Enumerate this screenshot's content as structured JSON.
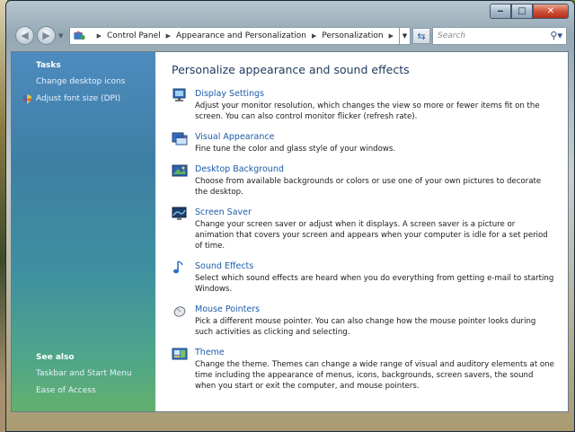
{
  "window": {
    "buttons": {
      "minimize": "‒",
      "maximize": "□",
      "close": "✕"
    }
  },
  "nav": {
    "back_icon": "back-arrow-icon",
    "forward_icon": "forward-arrow-icon",
    "breadcrumbs": [
      "Control Panel",
      "Appearance and Personalization",
      "Personalization"
    ],
    "search_placeholder": "Search"
  },
  "sidebar": {
    "tasks_heading": "Tasks",
    "tasks": [
      {
        "label": "Change desktop icons"
      },
      {
        "label": "Adjust font size (DPI)",
        "icon": "shield-icon"
      }
    ],
    "see_also_heading": "See also",
    "see_also": [
      {
        "label": "Taskbar and Start Menu"
      },
      {
        "label": "Ease of Access"
      }
    ]
  },
  "main": {
    "title": "Personalize appearance and sound effects",
    "items": [
      {
        "icon": "display-icon",
        "link": "Display Settings",
        "desc": "Adjust your monitor resolution, which changes the view so more or fewer items fit on the screen. You can also control monitor flicker (refresh rate)."
      },
      {
        "icon": "visual-appearance-icon",
        "link": "Visual Appearance",
        "desc": "Fine tune the color and glass style of your windows."
      },
      {
        "icon": "desktop-background-icon",
        "link": "Desktop Background",
        "desc": "Choose from available backgrounds or colors or use one of your own pictures to decorate the desktop."
      },
      {
        "icon": "screen-saver-icon",
        "link": "Screen Saver",
        "desc": "Change your screen saver or adjust when it displays. A screen saver is a picture or animation that covers your screen and appears when your computer is idle for a set period of time."
      },
      {
        "icon": "sound-icon",
        "link": "Sound Effects",
        "desc": "Select which sound effects are heard when you do everything from getting e-mail to starting Windows."
      },
      {
        "icon": "mouse-icon",
        "link": "Mouse Pointers",
        "desc": "Pick a different mouse pointer. You can also change how the mouse pointer looks during such activities as clicking and selecting."
      },
      {
        "icon": "theme-icon",
        "link": "Theme",
        "desc": "Change the theme. Themes can change a wide range of visual and auditory elements at one time including the appearance of menus, icons, backgrounds, screen savers, the sound when you start or exit the computer, and mouse pointers."
      }
    ]
  },
  "colors": {
    "link": "#1c5ca8",
    "title": "#1e395b",
    "sidebar_top": "#4e8bbf",
    "sidebar_bottom": "#63b06d"
  }
}
